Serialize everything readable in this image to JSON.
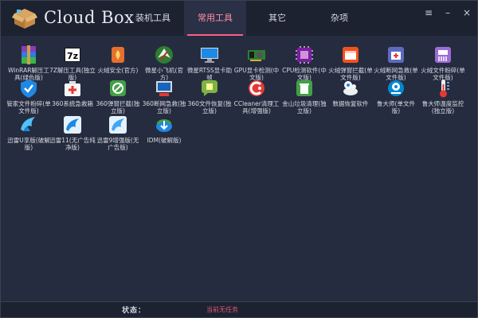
{
  "app": {
    "title": "Cloud Box"
  },
  "tabs": [
    {
      "label": "装机工具",
      "active": false
    },
    {
      "label": "常用工具",
      "active": true
    },
    {
      "label": "其它",
      "active": false
    },
    {
      "label": "杂项",
      "active": false
    }
  ],
  "window_controls": {
    "menu": "≡",
    "minimize": "–",
    "close": "×"
  },
  "tools": [
    {
      "label": "WinRAR解压工具(绿色版)",
      "icon": "winrar-icon"
    },
    {
      "label": "7Z解压工具(独立版)",
      "icon": "7zip-icon"
    },
    {
      "label": "火绒安全(官方)",
      "icon": "huorong-icon"
    },
    {
      "label": "微星小飞机(官方)",
      "icon": "afterburner-icon"
    },
    {
      "label": "微星RTSS显卡助帧",
      "icon": "monitor-icon"
    },
    {
      "label": "GPU显卡检测(中文版)",
      "icon": "gpu-card-icon"
    },
    {
      "label": "CPU检测软件(中文版)",
      "icon": "cpu-chip-icon"
    },
    {
      "label": "火绒弹窗拦截(单文件版)",
      "icon": "popup-block-icon"
    },
    {
      "label": "火绒断网急救(单文件版)",
      "icon": "first-aid-icon"
    },
    {
      "label": "火绒文件粉碎(单文件版)",
      "icon": "shredder-icon"
    },
    {
      "label": "管家文件粉碎(单文件版)",
      "icon": "shield-icon"
    },
    {
      "label": "360系统急救箱",
      "icon": "rescue-box-icon"
    },
    {
      "label": "360弹窗拦截(独立版)",
      "icon": "block-circle-icon"
    },
    {
      "label": "360断网急救(独立版)",
      "icon": "network-repair-icon"
    },
    {
      "label": "360文件恢复(独立版)",
      "icon": "file-recover-icon"
    },
    {
      "label": "CCleaner清理工具(增强版)",
      "icon": "ccleaner-icon"
    },
    {
      "label": "金山垃圾清理(独立版)",
      "icon": "trash-clean-icon"
    },
    {
      "label": "数据恢复软件",
      "icon": "data-recovery-icon"
    },
    {
      "label": "鲁大师(单文件版)",
      "icon": "ludashi-icon"
    },
    {
      "label": "鲁大师温度监控(独立版)",
      "icon": "thermometer-icon"
    },
    {
      "label": "迅雷U享版(破解版)",
      "icon": "thunder-icon"
    },
    {
      "label": "迅雷11(无广告纯净版)",
      "icon": "thunder-icon"
    },
    {
      "label": "迅雷9增强版(无广告版)",
      "icon": "thunder-icon"
    },
    {
      "label": "IDM(破解版)",
      "icon": "idm-icon"
    }
  ],
  "status": {
    "label": "状态：",
    "value": "当前无任务"
  },
  "colors": {
    "accent": "#ff5f86",
    "background": "#262c3f",
    "header": "#1d2231"
  }
}
